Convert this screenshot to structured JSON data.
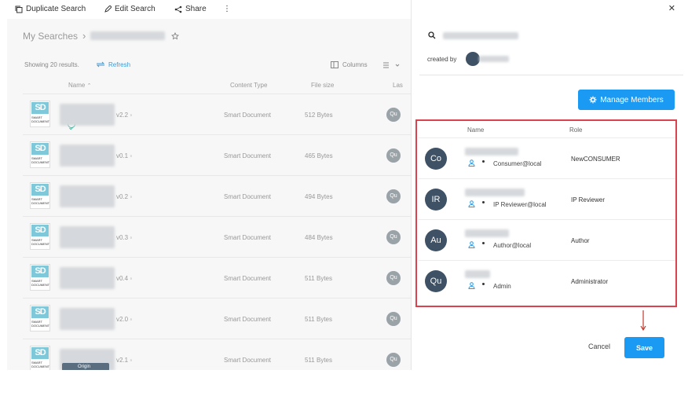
{
  "toolbar": {
    "duplicate_label": "Duplicate Search",
    "edit_label": "Edit Search",
    "share_label": "Share",
    "more_label": "⋮"
  },
  "breadcrumb": {
    "root": "My Searches",
    "separator": "›"
  },
  "results": {
    "count_text": "Showing 20 results.",
    "refresh_label": "Refresh",
    "columns_label": "Columns"
  },
  "table": {
    "headers": {
      "name": "Name",
      "content_type": "Content Type",
      "file_size": "File size",
      "last": "Las"
    },
    "rows": [
      {
        "version": "v2.2",
        "content_type": "Smart Document",
        "file_size": "512 Bytes",
        "owner": "Qu"
      },
      {
        "version": "v0.1",
        "content_type": "Smart Document",
        "file_size": "465 Bytes",
        "owner": "Qu"
      },
      {
        "version": "v0.2",
        "content_type": "Smart Document",
        "file_size": "494 Bytes",
        "owner": "Qu"
      },
      {
        "version": "v0.3",
        "content_type": "Smart Document",
        "file_size": "484 Bytes",
        "owner": "Qu"
      },
      {
        "version": "v0.4",
        "content_type": "Smart Document",
        "file_size": "511 Bytes",
        "owner": "Qu"
      },
      {
        "version": "v2.0",
        "content_type": "Smart Document",
        "file_size": "511 Bytes",
        "owner": "Qu"
      },
      {
        "version": "v2.1",
        "content_type": "Smart Document",
        "file_size": "511 Bytes",
        "owner": "Qu"
      }
    ],
    "thumb_text": "SD",
    "origin_label": "Origin"
  },
  "panel": {
    "close_label": "✕",
    "created_by_label": "created by",
    "manage_members_label": "Manage Members",
    "members_headers": {
      "name": "Name",
      "role": "Role"
    },
    "members": [
      {
        "initials": "Co",
        "login": "Consumer@local",
        "role": "NewCONSUMER"
      },
      {
        "initials": "IR",
        "login": "IP Reviewer@local",
        "role": "IP Reviewer"
      },
      {
        "initials": "Au",
        "login": "Author@local",
        "role": "Author"
      },
      {
        "initials": "Qu",
        "login": "Admin",
        "role": "Administrator"
      }
    ],
    "cancel_label": "Cancel",
    "save_label": "Save"
  },
  "colors": {
    "accent": "#1a9af2",
    "highlight_border": "#d9434f",
    "avatar": "#3e5165"
  }
}
